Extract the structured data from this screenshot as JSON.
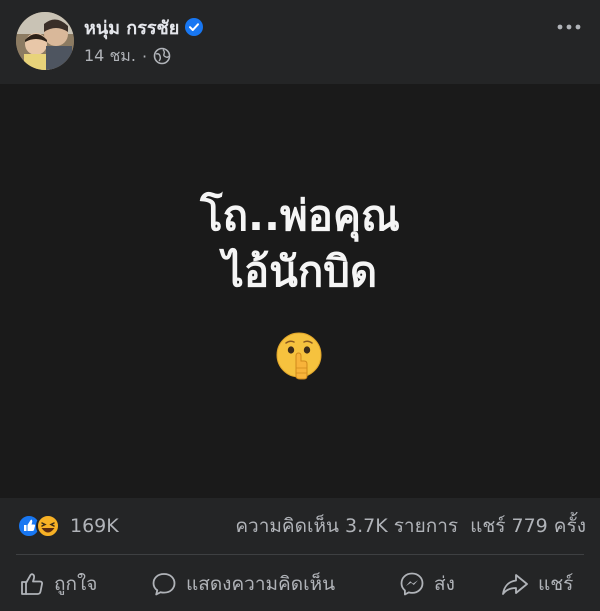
{
  "post": {
    "author": "หนุ่ม กรรชัย",
    "time": "14 ชม.",
    "separator": "·",
    "text_line1": "โถ..พ่อคุณ",
    "text_line2": "ไอ้นักบิด",
    "emoji_name": "shushing-face-emoji"
  },
  "stats": {
    "reactions": "169K",
    "comments": "ความคิดเห็น 3.7K รายการ",
    "shares": "แชร์ 779 ครั้ง"
  },
  "actions": {
    "like": "ถูกใจ",
    "comment": "แสดงความคิดเห็น",
    "send": "ส่ง",
    "share": "แชร์"
  },
  "colors": {
    "background": "#242526",
    "content_bg": "#1a1a1a",
    "text_primary": "#e4e6eb",
    "text_secondary": "#b0b3b8",
    "verified": "#1877f2",
    "like": "#1877f2",
    "haha": "#f7b125"
  }
}
